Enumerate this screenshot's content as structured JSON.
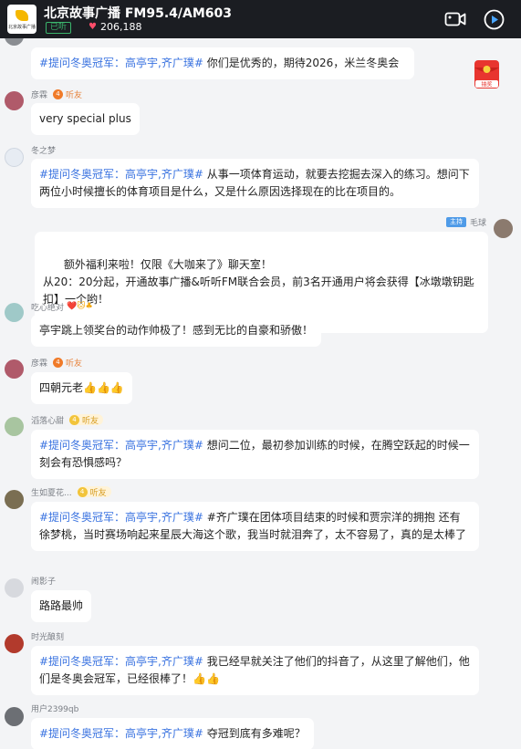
{
  "header": {
    "title": "北京故事广播 FM95.4/AM603",
    "status": "已听",
    "fans": "206,188",
    "logo_text": "北京故事广播"
  },
  "floating": {
    "lottery_label": "抽奖"
  },
  "messages": [
    {
      "user": "",
      "level": "",
      "parts": [
        {
          "t": "tag",
          "v": "#提问冬奥冠军：高亭宇,齐广璞#"
        },
        {
          "t": "text",
          "v": " 你们是优秀的，期待2026，米兰冬奥会"
        }
      ]
    },
    {
      "user": "彦霖",
      "level": "听友",
      "parts": [
        {
          "t": "text",
          "v": "very special plus"
        }
      ]
    },
    {
      "user": "冬之梦",
      "level": "",
      "parts": [
        {
          "t": "tag",
          "v": "#提问冬奥冠军：高亭宇,齐广璞#"
        },
        {
          "t": "text",
          "v": " 从事一项体育运动，就要去挖掘去深入的练习。想问下两位小时候擅长的体育项目是什么，又是什么原因选择现在的比在项目的。"
        }
      ]
    },
    {
      "user": "毛球",
      "level": "主持",
      "parts": [
        {
          "t": "text",
          "v": "额外福利来啦！仅限《大咖来了》聊天室！\n从20：20分起，开通故事广播&听听FM联合会员，前3名开通用户将会获得【冰墩墩钥匙扣】一个哟！"
        }
      ]
    },
    {
      "user": "吃心绝对",
      "level": "",
      "parts": [
        {
          "t": "text",
          "v": "亭宇跳上领奖台的动作帅极了！感到无比的自豪和骄傲！"
        }
      ]
    },
    {
      "user": "彦霖",
      "level": "听友",
      "parts": [
        {
          "t": "text",
          "v": "四朝元老"
        },
        {
          "t": "emoji",
          "v": "👍👍👍"
        }
      ]
    },
    {
      "user": "滔落心甜",
      "level": "听友",
      "parts": [
        {
          "t": "tag",
          "v": "#提问冬奥冠军：高亭宇,齐广璞#"
        },
        {
          "t": "text",
          "v": " 想问二位，最初参加训练的时候，在腾空跃起的时候一刻会有恐惧感吗？"
        }
      ]
    },
    {
      "user": "生如夏花...",
      "level": "听友",
      "parts": [
        {
          "t": "tag",
          "v": "#提问冬奥冠军：高亭宇,齐广璞#"
        },
        {
          "t": "text",
          "v": " #齐广璞在团体项目结束的时候和贾宗洋的拥抱 还有徐梦桃，当时赛场响起来星辰大海这个歌，我当时就泪奔了，太不容易了，真的是太棒了"
        }
      ]
    },
    {
      "user": "闹影子",
      "level": "",
      "parts": [
        {
          "t": "text",
          "v": "路路最帅"
        }
      ]
    },
    {
      "user": "时光酿刻",
      "level": "",
      "parts": [
        {
          "t": "tag",
          "v": "#提问冬奥冠军：高亭宇,齐广璞#"
        },
        {
          "t": "text",
          "v": " 我已经早就关注了他们的抖音了，从这里了解他们，他们是冬奥会冠军，已经很棒了！"
        },
        {
          "t": "emoji",
          "v": "👍👍"
        }
      ]
    },
    {
      "user": "用户2399qb",
      "level": "",
      "parts": [
        {
          "t": "tag",
          "v": "#提问冬奥冠军：高亭宇,齐广璞#"
        },
        {
          "t": "text",
          "v": " 夺冠到底有多难呢？"
        }
      ]
    }
  ],
  "level_icons": {
    "fan": "4"
  },
  "colors": {
    "tag": "#3a73e0",
    "topbar": "#1b1d22",
    "level": "#e7823a",
    "status": "#3bb56c"
  }
}
